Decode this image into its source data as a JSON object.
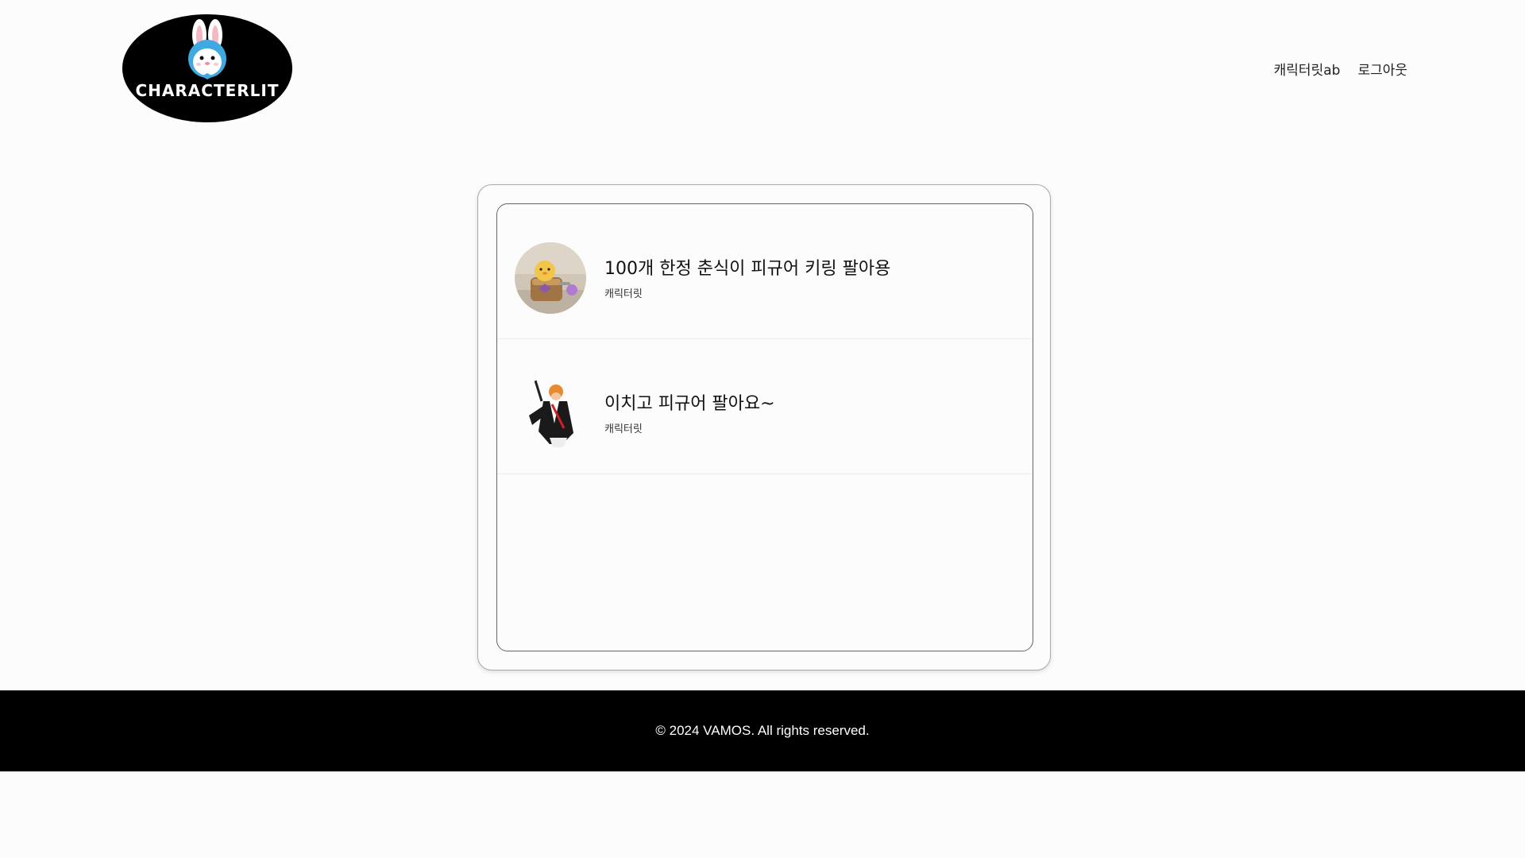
{
  "header": {
    "logo_text": "CHARACTERLIT",
    "nav": {
      "username": "캐릭터릿ab",
      "logout": "로그아웃"
    }
  },
  "list": {
    "items": [
      {
        "title": "100개 한정 춘식이 피규어 키링 팔아용",
        "seller": "캐릭터릿",
        "thumb_icon": "chunsik-figure-keyring-image"
      },
      {
        "title": "이치고 피규어 팔아요~",
        "seller": "캐릭터릿",
        "thumb_icon": "ichigo-figure-image"
      }
    ]
  },
  "footer": {
    "copyright": "© 2024 VAMOS. All rights reserved."
  },
  "colors": {
    "background": "#fcfcfc",
    "footer": "#000000",
    "logo_bg": "#000000",
    "bunny_blue": "#3fa9e0"
  }
}
